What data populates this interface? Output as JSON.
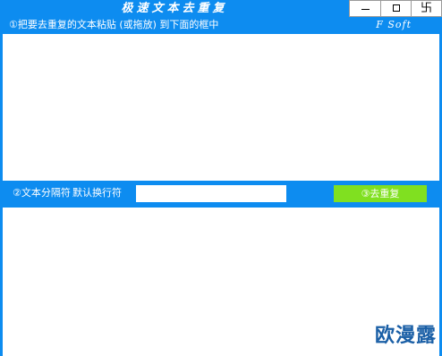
{
  "window": {
    "title": "极速文本去重复",
    "controls": {
      "minimize_icon": "minimize-icon",
      "maximize_icon": "maximize-icon",
      "close_glyph": "卐"
    }
  },
  "header": {
    "instruction": "①把要去重复的文本粘贴 (或拖放) 到下面的框中",
    "brand": "F Soft"
  },
  "input_area": {
    "value": ""
  },
  "separator_row": {
    "label": "②文本分隔符",
    "default_hint": "默认换行符",
    "input_value": "",
    "dedupe_button_label": "③去重复"
  },
  "output_area": {
    "value": ""
  },
  "watermark": {
    "text": "欧漫露"
  },
  "colors": {
    "window_bg": "#0d8cf0",
    "button_green": "#80e020",
    "watermark": "#1a5fa6"
  }
}
